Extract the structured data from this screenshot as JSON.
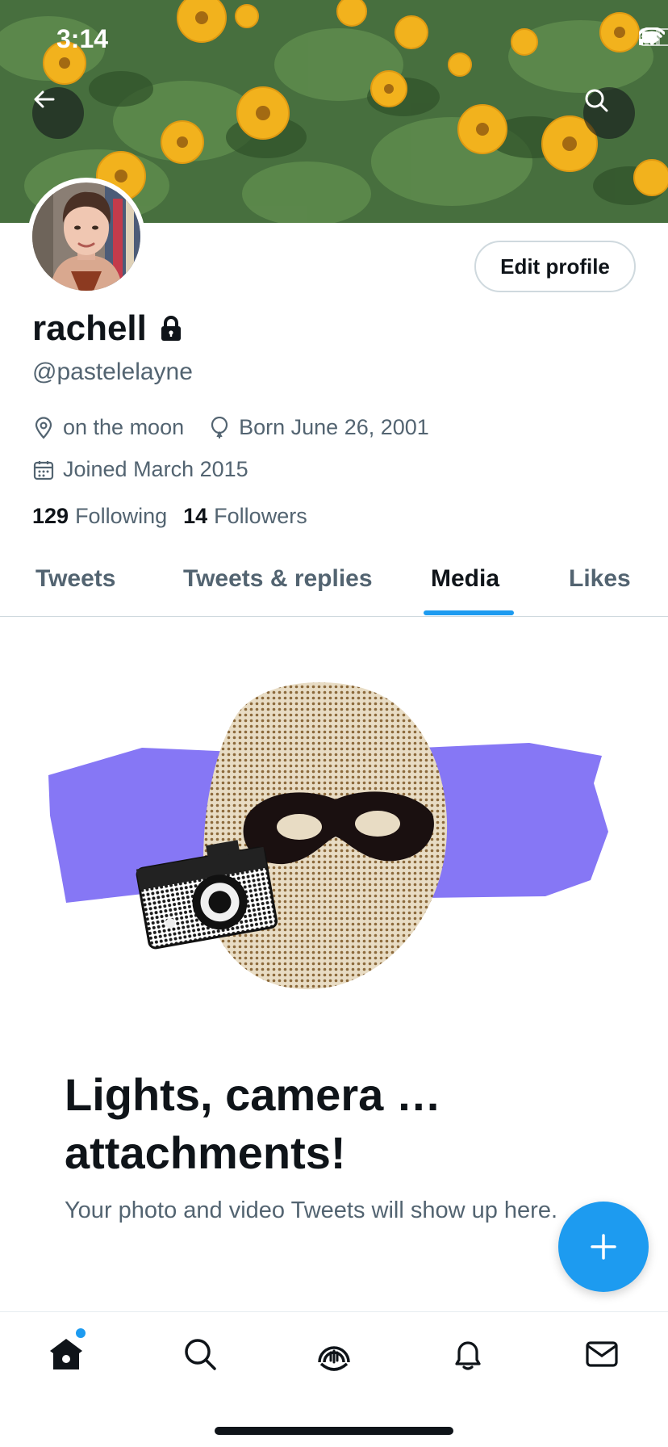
{
  "status_bar": {
    "time": "3:14"
  },
  "profile": {
    "display_name": "rachell",
    "handle": "@pastelelayne",
    "location": "on the moon",
    "birthday": "Born June 26, 2001",
    "joined": "Joined March 2015",
    "following_count": "129",
    "following_label": "Following",
    "followers_count": "14",
    "followers_label": "Followers",
    "edit_profile_label": "Edit profile",
    "locked": true
  },
  "tabs": [
    {
      "label": "Tweets",
      "active": false
    },
    {
      "label": "Tweets & replies",
      "active": false
    },
    {
      "label": "Media",
      "active": true
    },
    {
      "label": "Likes",
      "active": false
    }
  ],
  "empty_state": {
    "title": "Lights, camera … attachments!",
    "subtitle": "Your photo and video Tweets will show up here."
  },
  "bottom_nav": [
    {
      "icon": "home-icon",
      "active": true,
      "has_badge": true
    },
    {
      "icon": "search-icon",
      "active": false
    },
    {
      "icon": "spaces-icon",
      "active": false
    },
    {
      "icon": "bell-icon",
      "active": false
    },
    {
      "icon": "mail-icon",
      "active": false
    }
  ],
  "colors": {
    "accent": "#1d9bf0",
    "text_primary": "#0f1419",
    "text_secondary": "#536471",
    "illustration_purple": "#8677f5"
  }
}
